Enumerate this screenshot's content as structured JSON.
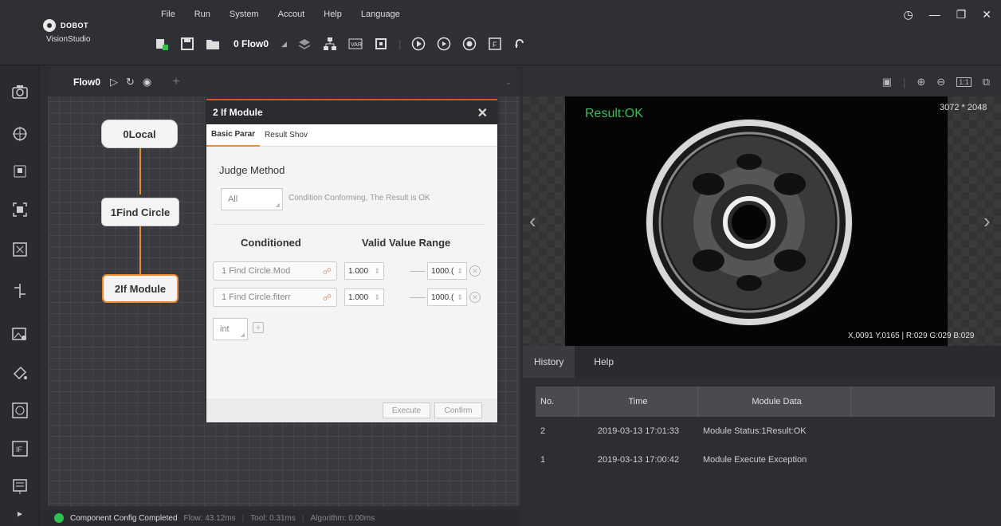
{
  "app": {
    "brand": "DOBOT",
    "product": "VisionStudio"
  },
  "menu": [
    "File",
    "Run",
    "System",
    "Accout",
    "Help",
    "Language"
  ],
  "toolbar": {
    "flow_select": "0 Flow0"
  },
  "flow": {
    "tab_label": "Flow0"
  },
  "nodes": {
    "n0": "0Local",
    "n1": "1Find Circle",
    "n2": "2If Module"
  },
  "dialog": {
    "title": "2 If Module",
    "tabs": [
      "Basic Parar",
      "Result Shov"
    ],
    "judge_method_label": "Judge Method",
    "judge_value": "All",
    "judge_desc": "Condition Conforming, The Result is OK",
    "conditioned_header": "Conditioned",
    "range_header": "Valid Value Range",
    "rows": [
      {
        "field": "1 Find Circle.Mod",
        "min": "1.000",
        "max": "1000.("
      },
      {
        "field": "1 Find Circle.fiterr",
        "min": "1.000",
        "max": "1000.("
      }
    ],
    "type_value": "int",
    "execute": "Execute",
    "confirm": "Confirm"
  },
  "status": {
    "message": "Component Config Completed",
    "flow_time": "Flow: 43.12ms",
    "tool_time": "Tool: 0.31ms",
    "algo_time": "Algorithm: 0.00ms"
  },
  "viewer": {
    "result": "Result:OK",
    "dimensions": "3072 * 2048",
    "pixel_info": "X,0091 Y,0165 | R:029 G:029 B:029"
  },
  "bottom_tabs": [
    "History",
    "Help"
  ],
  "history": {
    "headers": [
      "No.",
      "Time",
      "Module Data"
    ],
    "rows": [
      {
        "no": "2",
        "time": "2019-03-13 17:01:33",
        "data": "Module Status:1Result:OK"
      },
      {
        "no": "1",
        "time": "2019-03-13 17:00:42",
        "data": "Module Execute Exception"
      }
    ]
  },
  "colors": {
    "accent": "#f08a30",
    "ok": "#3cb95a",
    "dialog_border": "#e0502a"
  }
}
